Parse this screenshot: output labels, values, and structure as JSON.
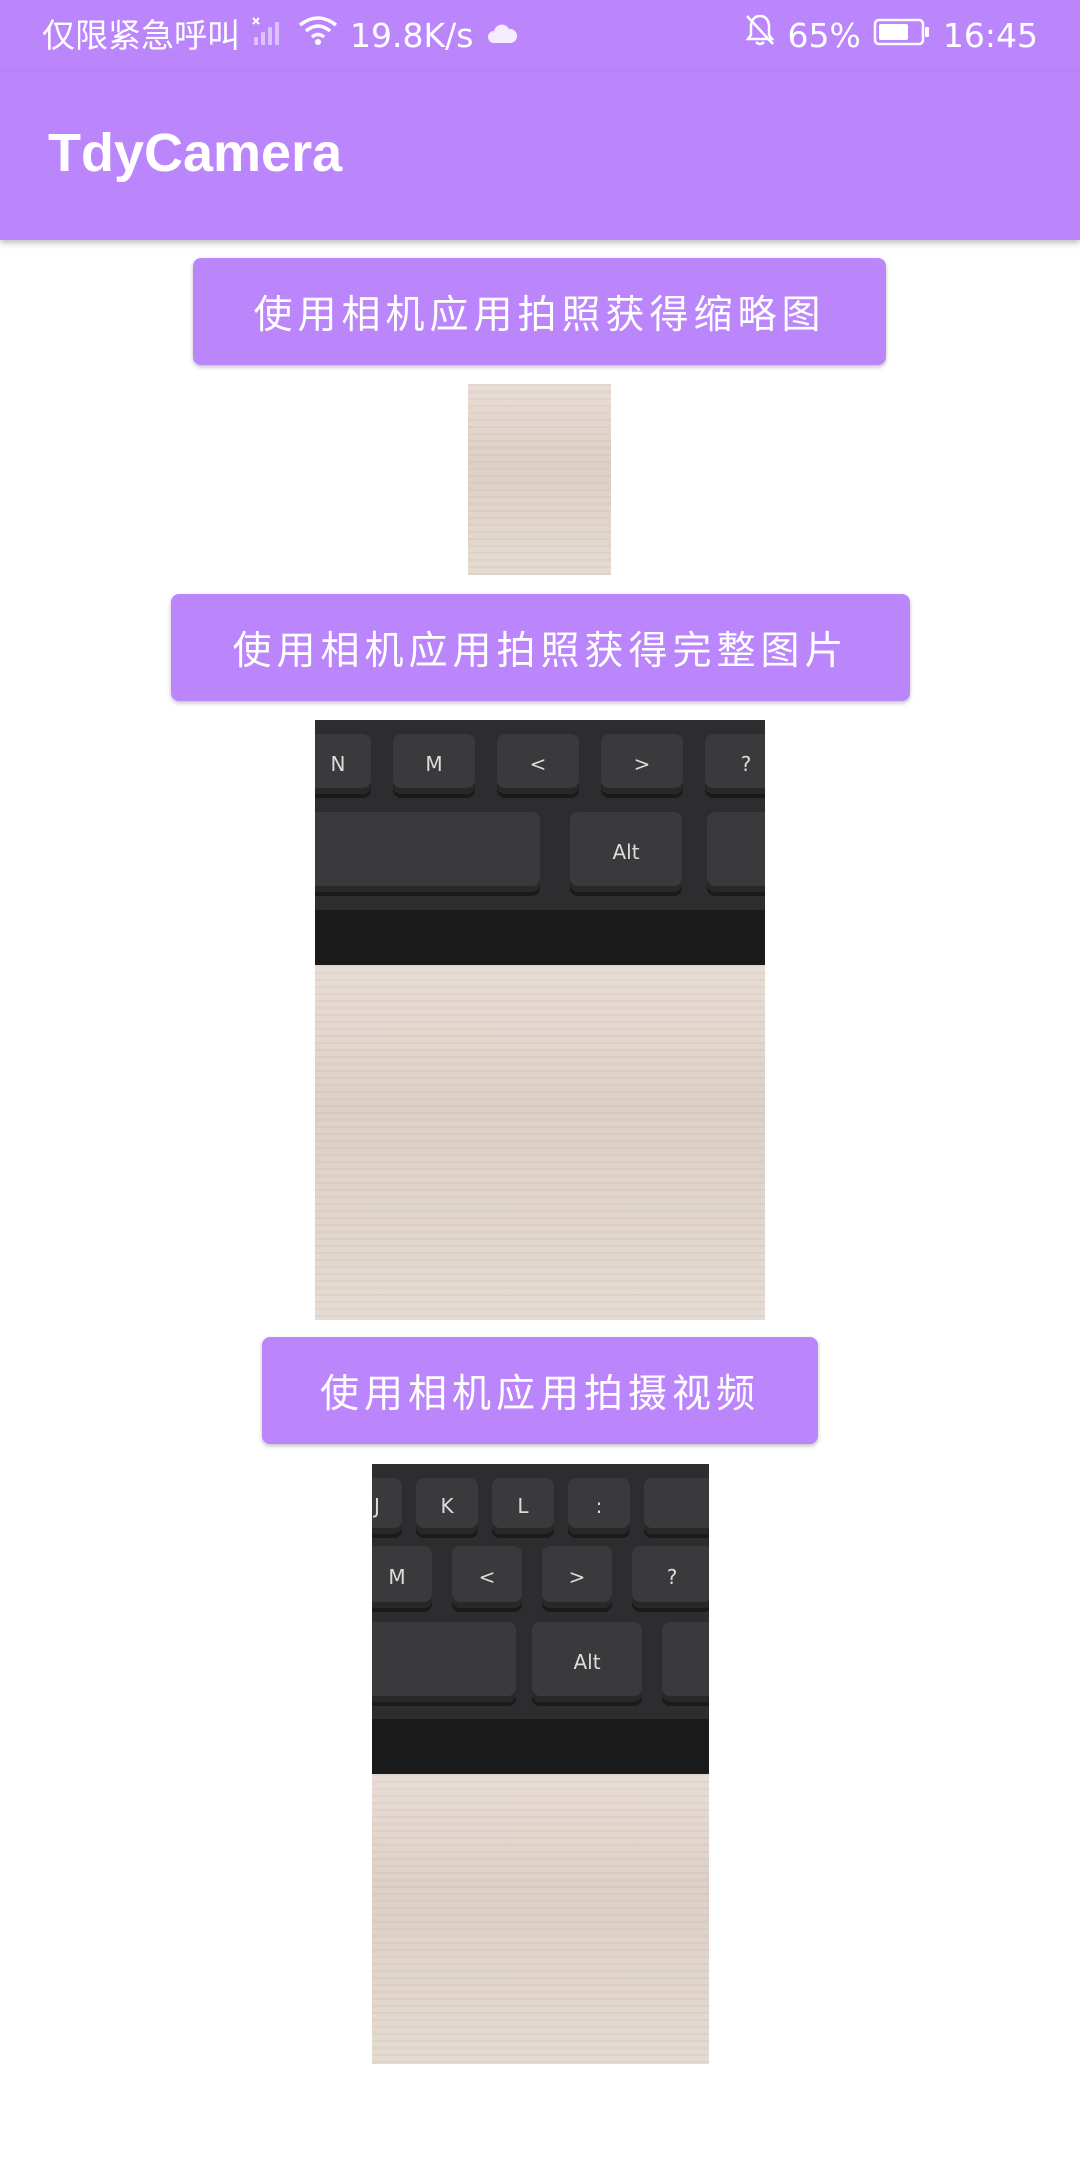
{
  "status_bar": {
    "carrier": "仅限紧急呼叫",
    "net_speed": "19.8K/s",
    "battery": "65%",
    "time": "16:45"
  },
  "app_bar": {
    "title": "TdyCamera"
  },
  "buttons": {
    "thumbnail": "使用相机应用拍照获得缩略图",
    "full_image": "使用相机应用拍照获得完整图片",
    "video": "使用相机应用拍摄视频"
  },
  "keys": {
    "n": "N",
    "m": "M",
    "lt": "<",
    "gt": ">",
    "q": "?",
    "alt": "Alt",
    "j": "J",
    "k": "K",
    "l": "L",
    "colon": ":"
  },
  "colors": {
    "accent": "#BB86FC",
    "on_accent": "#FFFFFF"
  }
}
